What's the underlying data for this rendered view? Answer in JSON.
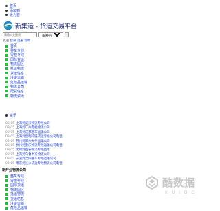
{
  "top_links": [
    "首页",
    "添加到收藏",
    "设为首页"
  ],
  "top_links_visible": [
    "添加到",
    "设为首"
  ],
  "logo": {
    "text": "新集运 - 货运交易平台"
  },
  "search": {
    "placeholder": "请输入关键词",
    "select_value": "请选择分类"
  },
  "login": {
    "welcome": "欢迎",
    "login": "登录",
    "register": "注册",
    "help": "帮助"
  },
  "main_nav": [
    "首页",
    "整车专线",
    "零担专线",
    "国际货运",
    "物流园区",
    "托运物流",
    "货运信息",
    "冷链运输",
    "危险品运输",
    "物流公司",
    "配货信息",
    "物流资讯"
  ],
  "crumb": "资讯",
  "articles": [
    {
      "date": "03-05",
      "title": "上海到武汉物流专线公司"
    },
    {
      "date": "03-05",
      "title": "上海到广州零担物流公司"
    },
    {
      "date": "03-05",
      "title": "上海到成都整车运输公司"
    },
    {
      "date": "03-05",
      "title": "上海到昆明冷链货运专线公司电话"
    },
    {
      "date": "03-05",
      "title": "苏州到郑州大件运输公司"
    },
    {
      "date": "03-05",
      "title": "杭州到重庆物流专线运输公司电话"
    },
    {
      "date": "03-05",
      "title": "无锡到西安物流专线直达"
    },
    {
      "date": "03-05",
      "title": "上海到乌鲁木齐物流公司"
    },
    {
      "date": "03-05",
      "title": "宁波到沈阳整车专线运输公司"
    },
    {
      "date": "03-05",
      "title": "南京到长沙货运专线物流公司电话"
    }
  ],
  "category_title": "新开业物流公司",
  "bottom_nav": [
    "整车专线",
    "零担专线",
    "国际货运",
    "物流园区",
    "托运物流",
    "货运信息",
    "冷链运输",
    "危险品运输"
  ],
  "watermark": {
    "text": "酷数据",
    "sub": "KUIDC"
  },
  "colors": {
    "link": "#1a3fd6",
    "green": "#2db845",
    "logo_blue": "#1b2a7a"
  }
}
